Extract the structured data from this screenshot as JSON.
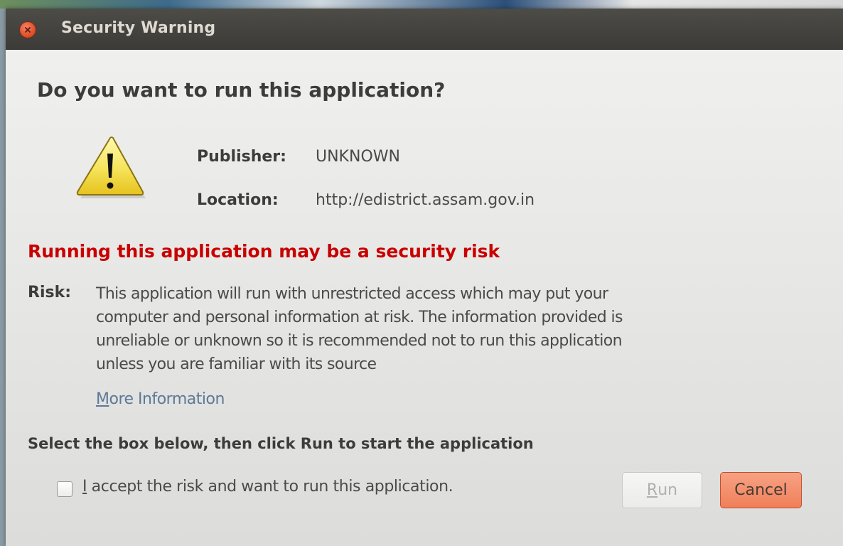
{
  "dialog": {
    "title": "Security Warning",
    "question": "Do you want to run this application?",
    "publisher_label": "Publisher:",
    "publisher_value": "UNKNOWN",
    "location_label": "Location:",
    "location_value": "http://edistrict.assam.gov.in",
    "risk_heading": "Running this application may be a security risk",
    "risk_label": "Risk:",
    "risk_text": "This application will run with unrestricted access which may put your\ncomputer and personal information at risk. The information provided is\nunreliable or unknown so it is recommended not to run this application\nunless you are familiar with its source",
    "more_info_mnemonic": "M",
    "more_info_rest": "ore Information",
    "select_instruction": "Select the box below, then click Run to start the application",
    "checkbox_checked": false,
    "accept_mnemonic": "I",
    "accept_rest": " accept the risk and want to run this application.",
    "run_mnemonic": "R",
    "run_rest": "un",
    "run_enabled": false,
    "cancel_label": "Cancel"
  },
  "colors": {
    "titlebar": "#3c3b37",
    "risk_heading": "#c80000",
    "cancel_button": "#ef7f5a",
    "link": "#5c7a96"
  },
  "icons": {
    "close": "close-icon",
    "warning": "warning-triangle-icon"
  }
}
